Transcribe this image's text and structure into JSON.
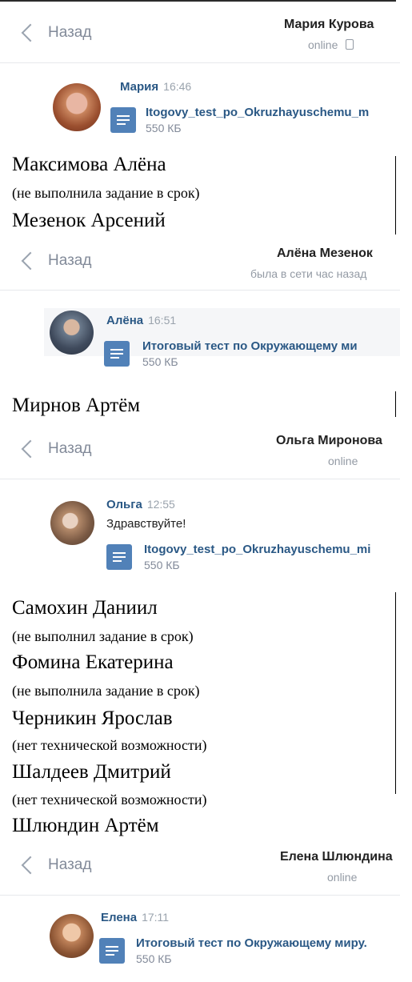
{
  "back_label": "Назад",
  "chats": [
    {
      "title": "Мария Курова",
      "status": "online",
      "sender": "Мария",
      "time": "16:46",
      "text": "",
      "file_name": "Itogovy_test_po_Okruzhayuschemu_m",
      "file_size": "550 КБ"
    },
    {
      "title": "Алёна Мезенок",
      "status": "была в сети час назад",
      "sender": "Алёна",
      "time": "16:51",
      "text": "",
      "file_name": "Итоговый тест по Окружающему ми",
      "file_size": "550 КБ"
    },
    {
      "title": "Ольга Миронова",
      "status": "online",
      "sender": "Ольга",
      "time": "12:55",
      "text": "Здравствуйте!",
      "file_name": "Itogovy_test_po_Okruzhayuschemu_mi",
      "file_size": "550 КБ"
    },
    {
      "title": "Елена Шлюндина",
      "status": "online",
      "sender": "Елена",
      "time": "17:11",
      "text": "",
      "file_name": "Итоговый тест по Окружающему миру.",
      "file_size": "550 КБ"
    }
  ],
  "students": [
    {
      "name": "Максимова Алёна",
      "note": "(не выполнила задание в срок)"
    },
    {
      "name": "Мезенок Арсений"
    },
    {
      "name": "Мирнов Артём"
    },
    {
      "name": "Самохин Даниил",
      "note": "(не выполнил задание в срок)"
    },
    {
      "name": "Фомина Екатерина",
      "note": "(не выполнила задание в срок)"
    },
    {
      "name": "Черникин Ярослав",
      "note": "(нет технической возможности)"
    },
    {
      "name": "Шалдеев Дмитрий",
      "note": "(нет технической возможности)"
    },
    {
      "name": "Шлюндин Артём"
    }
  ]
}
